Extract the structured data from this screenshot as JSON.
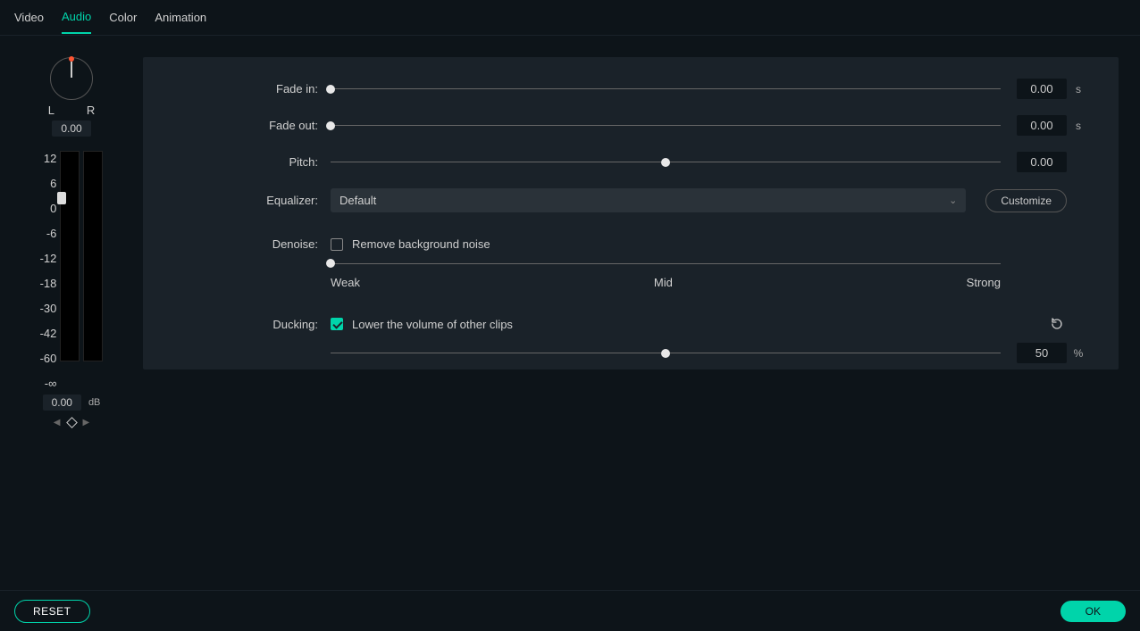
{
  "tabs": {
    "video": "Video",
    "audio": "Audio",
    "color": "Color",
    "animation": "Animation"
  },
  "pan": {
    "l": "L",
    "r": "R",
    "value": "0.00"
  },
  "meter": {
    "ticks": [
      "12",
      "6",
      "0",
      "-6",
      "-12",
      "-18",
      "-30",
      "-42",
      "-60",
      "-∞"
    ],
    "value": "0.00",
    "unit": "dB"
  },
  "labels": {
    "fadein": "Fade in:",
    "fadeout": "Fade out:",
    "pitch": "Pitch:",
    "equalizer": "Equalizer:",
    "denoise": "Denoise:",
    "ducking": "Ducking:"
  },
  "fadein": {
    "value": "0.00",
    "unit": "s"
  },
  "fadeout": {
    "value": "0.00",
    "unit": "s"
  },
  "pitch": {
    "value": "0.00"
  },
  "equalizer": {
    "selected": "Default",
    "customize": "Customize"
  },
  "denoise": {
    "check_label": "Remove background noise",
    "weak": "Weak",
    "mid": "Mid",
    "strong": "Strong"
  },
  "ducking": {
    "check_label": "Lower the volume of other clips",
    "value": "50",
    "unit": "%"
  },
  "footer": {
    "reset": "RESET",
    "ok": "OK"
  }
}
